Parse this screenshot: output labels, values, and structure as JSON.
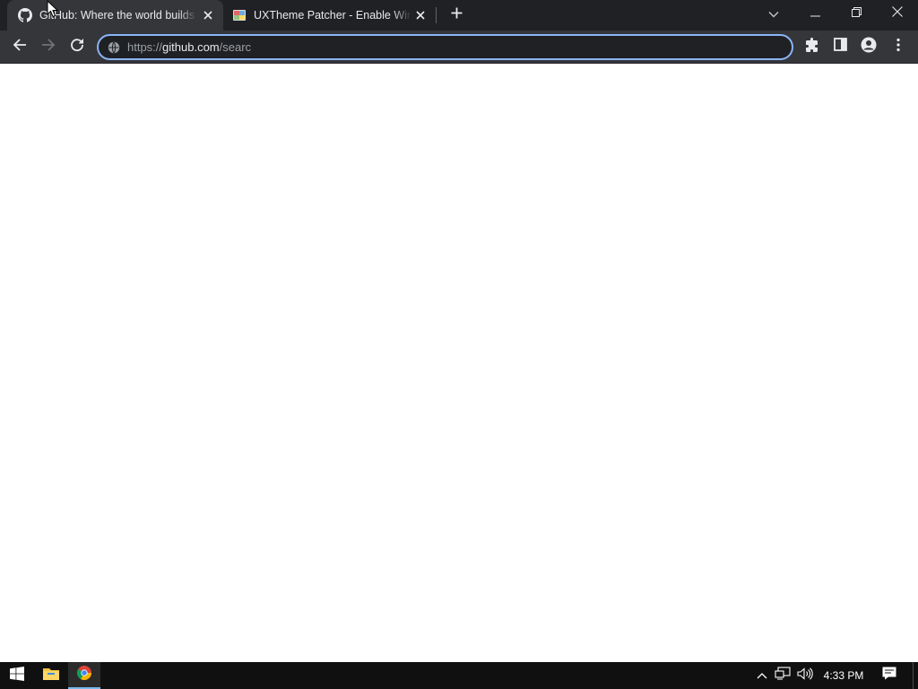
{
  "browser": {
    "tabs": [
      {
        "title": "GitHub: Where the world builds software",
        "favicon": "github-icon",
        "active": true
      },
      {
        "title": "UXTheme Patcher - Enable Windows Themes",
        "favicon": "uxtheme-favicon",
        "active": false
      }
    ],
    "address_bar": {
      "scheme": "https://",
      "host": "github.com",
      "path": "/searc"
    },
    "icons": {
      "back": "back-arrow-icon",
      "forward": "forward-arrow-icon",
      "reload": "reload-icon",
      "extensions": "puzzle-icon",
      "side_panel": "side-panel-icon",
      "profile": "profile-icon",
      "menu": "kebab-menu-icon",
      "new_tab": "plus-icon",
      "tab_search": "chevron-down-icon"
    }
  },
  "taskbar": {
    "clock": "4:33 PM",
    "apps": [
      "windows-start",
      "file-explorer",
      "chrome"
    ]
  },
  "colors": {
    "tabstrip_bg": "#202124",
    "toolbar_bg": "#35363a",
    "omnibox_border": "#8ab4f8",
    "taskbar_bg": "#101010",
    "page_bg": "#ffffff"
  }
}
